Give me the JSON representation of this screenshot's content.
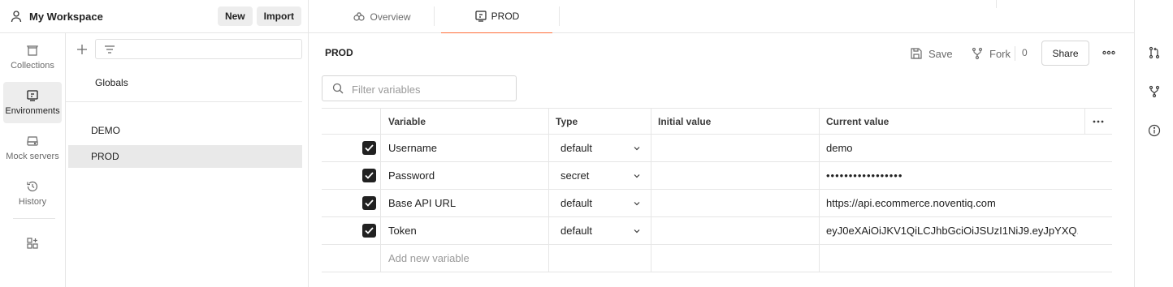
{
  "workspace": {
    "title": "My Workspace",
    "new_label": "New",
    "import_label": "Import"
  },
  "rail": {
    "items": [
      {
        "label": "Collections",
        "icon": "collections-icon"
      },
      {
        "label": "Environments",
        "icon": "environments-icon",
        "active": true
      },
      {
        "label": "Mock servers",
        "icon": "mock-servers-icon"
      },
      {
        "label": "History",
        "icon": "history-icon"
      }
    ],
    "apps_icon": "add-apps-icon"
  },
  "env_list": {
    "globals_label": "Globals",
    "items": [
      {
        "label": "DEMO"
      },
      {
        "label": "PROD",
        "selected": true
      }
    ]
  },
  "tabs": [
    {
      "label": "Overview",
      "icon": "overview-icon"
    },
    {
      "label": "PROD",
      "icon": "environment-icon",
      "active": true
    }
  ],
  "main": {
    "env_name": "PROD",
    "save_label": "Save",
    "fork_label": "Fork",
    "fork_count": "0",
    "share_label": "Share",
    "filter_placeholder": "Filter variables",
    "columns": {
      "variable": "Variable",
      "type": "Type",
      "initial": "Initial value",
      "current": "Current value"
    },
    "rows": [
      {
        "variable": "Username",
        "type": "default",
        "initial": "",
        "current": "demo",
        "enabled": true
      },
      {
        "variable": "Password",
        "type": "secret",
        "initial": "",
        "current": "•••••••••••••••••",
        "enabled": true
      },
      {
        "variable": "Base API URL",
        "type": "default",
        "initial": "",
        "current": "https://api.ecommerce.noventiq.com",
        "enabled": true
      },
      {
        "variable": "Token",
        "type": "default",
        "initial": "",
        "current": "eyJ0eXAiOiJKV1QiLCJhbGciOiJSUzI1NiJ9.eyJpYXQ...",
        "enabled": true
      }
    ],
    "add_new_placeholder": "Add new variable"
  },
  "right_rail": {
    "icons": [
      "pull-request-icon",
      "fork-icon",
      "info-icon"
    ]
  },
  "colors": {
    "accent": "#ff6c37",
    "checkbox": "#212121",
    "selected_bg": "#e9e9e9"
  }
}
